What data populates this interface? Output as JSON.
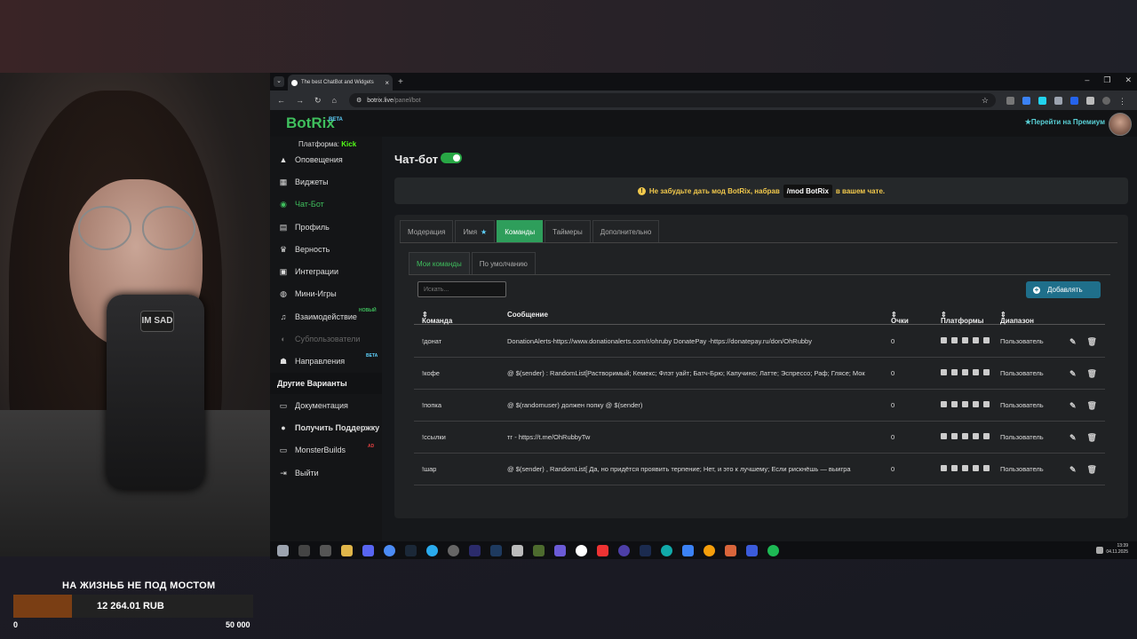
{
  "browser": {
    "tab_title": "The best ChatBot and Widgets",
    "url_host": "botrix.live",
    "url_path": "/panel/bot"
  },
  "app": {
    "logo": "BotRix",
    "logo_badge": "BETA",
    "premium_label": "Перейти на Премиум",
    "platform_label": "Платформа:",
    "platform_value": "Kick"
  },
  "sidebar": {
    "items": [
      {
        "label": "Оповещения",
        "icon": "warning-icon"
      },
      {
        "label": "Виджеты",
        "icon": "grid-icon"
      },
      {
        "label": "Чат-Бот",
        "icon": "robot-icon",
        "active": true
      },
      {
        "label": "Профиль",
        "icon": "id-card-icon"
      },
      {
        "label": "Верность",
        "icon": "trophy-icon"
      },
      {
        "label": "Интеграции",
        "icon": "plugin-icon"
      },
      {
        "label": "Мини-Игры",
        "icon": "gamepad-icon"
      },
      {
        "label": "Взаимодействие",
        "icon": "music-icon",
        "badge": "НОВЫЙ"
      },
      {
        "label": "Субпользователи",
        "icon": "users-icon",
        "disabled": true
      },
      {
        "label": "Направления",
        "icon": "people-icon",
        "badge": "BETA"
      }
    ],
    "section_title": "Другие Варианты",
    "other_items": [
      {
        "label": "Документация",
        "icon": "doc-icon"
      },
      {
        "label": "Получить Поддержку",
        "icon": "support-icon"
      },
      {
        "label": "MonsterBuilds",
        "icon": "laptop-icon",
        "badge": "AD"
      },
      {
        "label": "Выйти",
        "icon": "logout-icon"
      }
    ]
  },
  "main": {
    "title": "Чат-бот",
    "bot_enabled": true,
    "notice": {
      "before": "Не забудьте дать мод BotRix, набрав",
      "code": "/mod BotRix",
      "after": "в вашем чате."
    },
    "tabs": [
      "Модерация",
      "Имя",
      "Команды",
      "Таймеры",
      "Дополнительно"
    ],
    "active_tab": "Команды",
    "subtabs": [
      "Мои команды",
      "По умолчанию"
    ],
    "search_placeholder": "Искать...",
    "add_button": "Добавлять",
    "columns": [
      "Команда",
      "Сообщение",
      "Очки",
      "Платформы",
      "Диапазон"
    ],
    "rows": [
      {
        "command": "!донат",
        "message": "DonationAlerts-https://www.donationalerts.com/r/ohruby   DonatePay -https://donatepay.ru/don/OhRubby",
        "points": "0",
        "range": "Пользователь"
      },
      {
        "command": "!кофе",
        "message": "@ $(sender) : RandomList[Растворимый; Кемекс; Флэт уайт; Батч-Брю; Капучино; Латте; Эспрессо; Раф; Глясе; Мок",
        "points": "0",
        "range": "Пользователь"
      },
      {
        "command": "!попка",
        "message": "@ $(randomuser) должен попку @ $(sender)",
        "points": "0",
        "range": "Пользователь"
      },
      {
        "command": "!ссылки",
        "message": "тг - https://t.me/OhRubbyTw",
        "points": "0",
        "range": "Пользователь"
      },
      {
        "command": "!шар",
        "message": "@ $(sender) , RandomList[ Да, но придётся проявить терпение; Нет, и это к лучшему; Если рискнёшь — выигра",
        "points": "0",
        "range": "Пользователь"
      }
    ]
  },
  "taskbar": {
    "time": "13:39",
    "date": "04.11.2025"
  },
  "overlay": {
    "goal_title": "НА ЖИЗНЬБ НЕ ПОД МОСТОМ",
    "goal_amount": "12 264.01 RUB",
    "goal_min": "0",
    "goal_max": "50 000",
    "goal_progress": 0.245,
    "mic_label": "IM SAD"
  },
  "colors": {
    "accent_green": "#3fbf5d",
    "kick_green": "#53fc18",
    "notice_yellow": "#f2c94c",
    "add_button": "#1f6f8b",
    "goal_fill": "#7a3e14"
  }
}
